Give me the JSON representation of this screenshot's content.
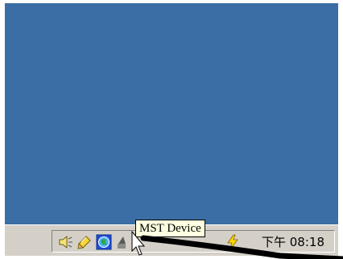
{
  "taskbar": {
    "clock": "下午 08:18"
  },
  "tray": {
    "icons": [
      "speaker-icon",
      "pencil-icon",
      "network-globe-icon",
      "mst-device-icon",
      "power-icon"
    ]
  },
  "tooltip": {
    "text": "MST Device"
  },
  "colors": {
    "desktop": "#3a6ea5",
    "taskbar": "#d4d0c8",
    "tooltip_bg": "#ffffe1"
  }
}
